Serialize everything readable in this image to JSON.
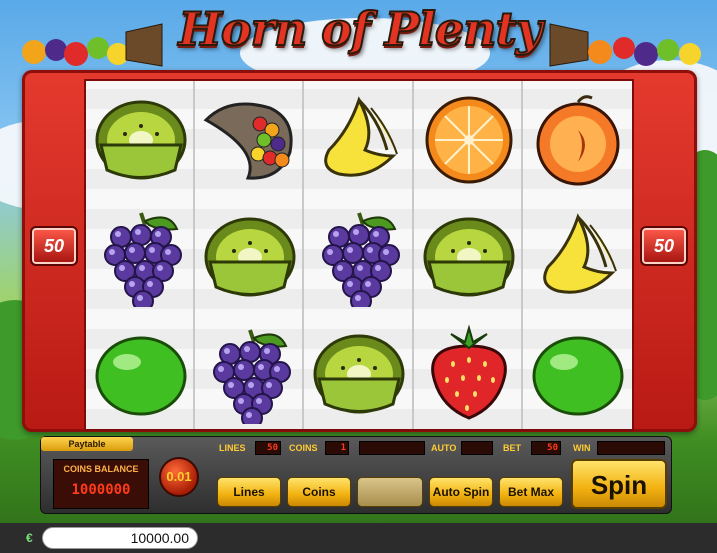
{
  "game": {
    "title": "Horn of Plenty"
  },
  "paylines": {
    "left": "50",
    "right": "50"
  },
  "reels": [
    [
      "kiwi",
      "grapes",
      "lime"
    ],
    [
      "cornucopia",
      "kiwi",
      "grapes"
    ],
    [
      "banana",
      "grapes",
      "kiwi"
    ],
    [
      "orange",
      "kiwi",
      "strawberry"
    ],
    [
      "peach",
      "banana",
      "lime"
    ]
  ],
  "console": {
    "paytable": "Paytable",
    "coins_balance_label": "COINS BALANCE",
    "coins_balance_value": "1000000",
    "coin_value": "0.01",
    "lines_label": "LINES",
    "lines_value": "50",
    "coins_label": "COINS",
    "coins_value": "1",
    "auto_label": "AUTO",
    "bet_label": "BET",
    "bet_value": "50",
    "win_label": "WIN",
    "btn_lines": "Lines",
    "btn_coins": "Coins",
    "btn_auto": "Auto Spin",
    "btn_bet_max": "Bet Max",
    "btn_spin": "Spin"
  },
  "footer": {
    "currency_symbol": "€",
    "balance": "10000.00"
  },
  "colors": {
    "frame_red": "#d42a20",
    "button_gold": "#f2b10f",
    "led_red": "#ff3b1a"
  }
}
